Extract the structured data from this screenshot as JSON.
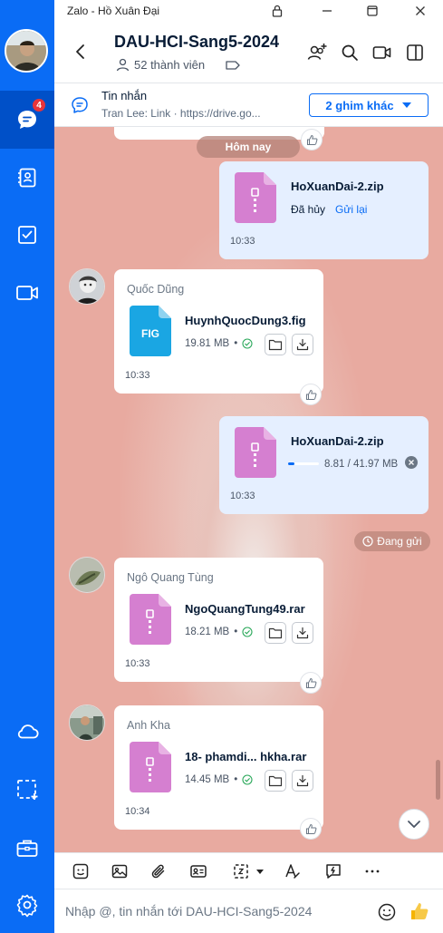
{
  "window": {
    "title": "Zalo - Hồ Xuân Đại"
  },
  "colors": {
    "primary": "#0a6cf5",
    "nav_active": "#0050c8",
    "badge": "#e8343b",
    "chat_bg": "#e8aaa0"
  },
  "nav": {
    "items": [
      {
        "name": "messages",
        "icon": "chat-bubble-icon",
        "badge": "4"
      },
      {
        "name": "contacts",
        "icon": "contact-book-icon"
      },
      {
        "name": "todo",
        "icon": "checkbox-icon"
      },
      {
        "name": "video",
        "icon": "video-camera-icon"
      },
      {
        "name": "cloud",
        "icon": "cloud-icon"
      },
      {
        "name": "screenshot",
        "icon": "capture-icon"
      },
      {
        "name": "toolbox",
        "icon": "briefcase-icon"
      },
      {
        "name": "settings",
        "icon": "gear-icon"
      }
    ]
  },
  "header": {
    "title": "DAU-HCI-Sang5-2024",
    "members": "52 thành viên"
  },
  "pinned": {
    "title": "Tin nhắn",
    "preview": "Tran Lee: Link · https://drive.go...",
    "more_label": "2 ghim khác"
  },
  "chat": {
    "date_label": "Hôm nay",
    "sending_label": "Đang gửi",
    "messages": [
      {
        "type": "out",
        "file": "HoXuanDai-2.zip",
        "status": "Đã hủy",
        "action": "Gửi lại",
        "time": "10:33"
      },
      {
        "type": "in",
        "sender": "Quốc Dũng",
        "file": "HuynhQuocDung3.fig",
        "file_badge": "FIG",
        "size": "19.81 MB",
        "time": "10:33"
      },
      {
        "type": "out",
        "file": "HoXuanDai-2.zip",
        "progress": "8.81 / 41.97 MB",
        "progress_fraction": 0.21,
        "time": "10:33"
      },
      {
        "type": "in",
        "sender": "Ngô Quang Tùng",
        "file": "NgoQuangTung49.rar",
        "size": "18.21 MB",
        "time": "10:33"
      },
      {
        "type": "in",
        "sender": "Anh Kha",
        "file": "18- phamdi... hkha.rar",
        "size": "14.45 MB",
        "time": "10:34"
      }
    ]
  },
  "composer": {
    "placeholder": "Nhập @, tin nhắn tới DAU-HCI-Sang5-2024"
  }
}
